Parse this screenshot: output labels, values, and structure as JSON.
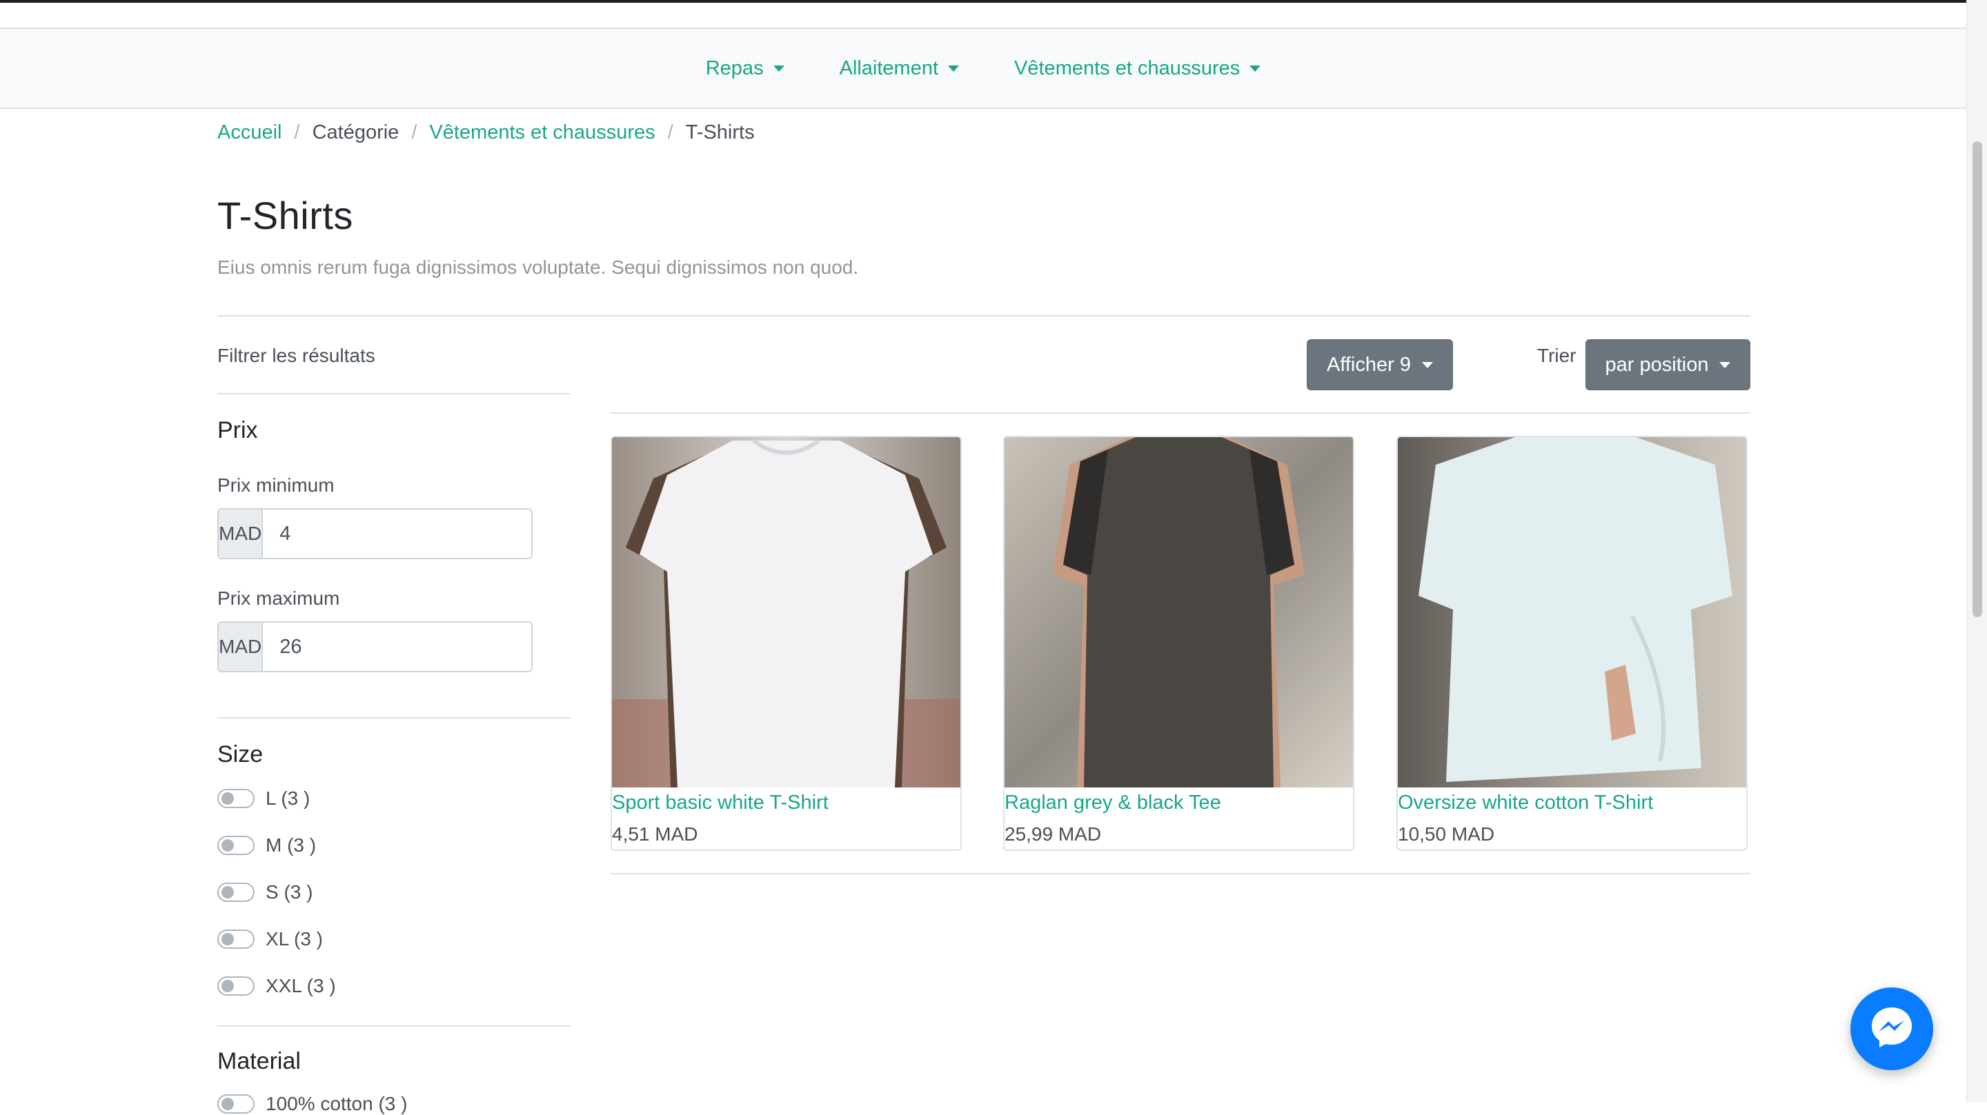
{
  "nav": {
    "items": [
      {
        "label": "Repas"
      },
      {
        "label": "Allaitement"
      },
      {
        "label": "Vêtements et chaussures"
      }
    ]
  },
  "breadcrumb": {
    "home": "Accueil",
    "category": "Catégorie",
    "parent": "Vêtements et chaussures",
    "current": "T-Shirts",
    "separator": "/"
  },
  "page": {
    "title": "T-Shirts",
    "description": "Eius omnis rerum fuga dignissimos voluptate. Sequi dignissimos non quod."
  },
  "filters": {
    "title": "Filtrer les résultats",
    "price": {
      "heading": "Prix",
      "min_label": "Prix minimum",
      "max_label": "Prix maximum",
      "currency": "MAD",
      "min_value": "4",
      "max_value": "26"
    },
    "size": {
      "heading": "Size",
      "options": [
        "L (3 )",
        "M (3 )",
        "S (3 )",
        "XL (3 )",
        "XXL (3 )"
      ]
    },
    "material": {
      "heading": "Material",
      "options": [
        "100% cotton (3 )"
      ]
    }
  },
  "toolbar": {
    "show_label": "Afficher 9",
    "sort_label": "Trier",
    "sort_value": "par position"
  },
  "products": [
    {
      "name": "Sport basic white T-Shirt",
      "price": "4,51 MAD"
    },
    {
      "name": "Raglan grey & black Tee",
      "price": "25,99 MAD"
    },
    {
      "name": "Oversize white cotton T-Shirt",
      "price": "10,50 MAD"
    }
  ],
  "colors": {
    "accent": "#17a689",
    "button": "#6c757d",
    "messenger": "#0a7cff"
  },
  "icons": {
    "messenger": "messenger-icon",
    "dropdown": "caret-down-icon"
  }
}
